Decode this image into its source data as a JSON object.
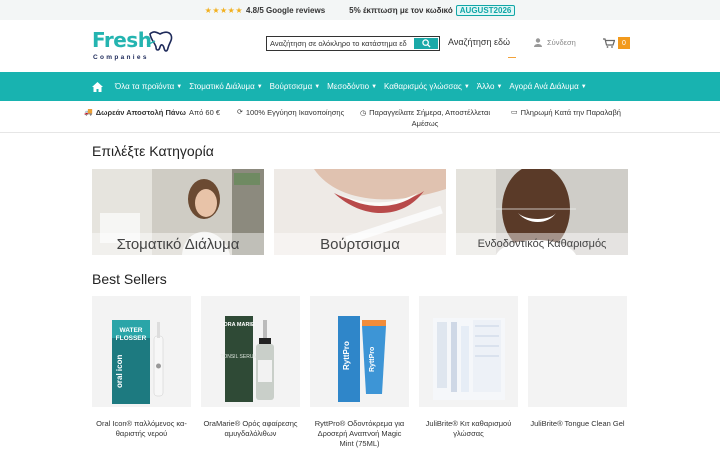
{
  "topbar": {
    "stars": "★★★★★",
    "rating": "4.8/5 Google reviews",
    "promo": "5% έκπτωση με τον κωδικό",
    "code": "AUGUST2026"
  },
  "header": {
    "logo_word": "Fresh",
    "logo_sub": "Companies",
    "search_value": "Αναζήτηση σε ολόκληρο το κατάστημα εδ",
    "search_hint": "Αναζήτηση εδώ",
    "login_label": "Σύνδεση",
    "cart_count": "0"
  },
  "nav": {
    "items": [
      {
        "label": "Όλα τα προϊόντα"
      },
      {
        "label": "Στοματικό Διάλυμα"
      },
      {
        "label": "Βούρτσισμα"
      },
      {
        "label": "Μεσοδόντιο"
      },
      {
        "label": "Καθαρισμός γλώσσας"
      },
      {
        "label": "Άλλο"
      },
      {
        "label": "Αγορά Ανά Διάλυμα"
      }
    ]
  },
  "benefits": {
    "shipping_bold": "Δωρεάν Αποστολή Πάνω",
    "shipping_rest": "Από 60 €",
    "guarantee": "100% Εγγύηση Ικανοποίησης",
    "order_line1": "Παραγγείλατε Σήμερα, Αποστέλλεται",
    "order_line2": "Αμέσως",
    "payment": "Πληρωμή Κατά την Παραλαβή"
  },
  "categories": {
    "title": "Επιλέξτε Κατηγορία",
    "items": [
      {
        "label": "Στοματικό Διάλυμα"
      },
      {
        "label": "Βούρτσισμα"
      },
      {
        "label": "Ενδοδοντικός Καθαρισμός"
      }
    ]
  },
  "bestsellers": {
    "title": "Best Sellers",
    "items": [
      {
        "name": "Oral Icon® παλλόμενος κα-θαριστής νερού",
        "box_text": "WATER FLOSSER",
        "brand_text": "oral icon"
      },
      {
        "name": "OraMarie® Ορός αφαίρεσης αμυγδαλόλιθων",
        "box_text": "ORA MARIE",
        "brand_text": "TONSIL SERUM"
      },
      {
        "name": "RyttPro® Οδοντόκρεμα για Δροσερή Αναπνοή Magic Mint (75ML)",
        "box_text": "RyttPro",
        "brand_text": "RyttPro"
      },
      {
        "name": "JuliBrite® Κιτ καθαρισμού γλώσσας",
        "box_text": "",
        "brand_text": ""
      },
      {
        "name": "JuliBrite® Tongue Clean Gel",
        "box_text": "",
        "brand_text": ""
      }
    ]
  },
  "colors": {
    "teal": "#18b3b0",
    "orange": "#f29a1c",
    "star": "#f2b01e"
  }
}
